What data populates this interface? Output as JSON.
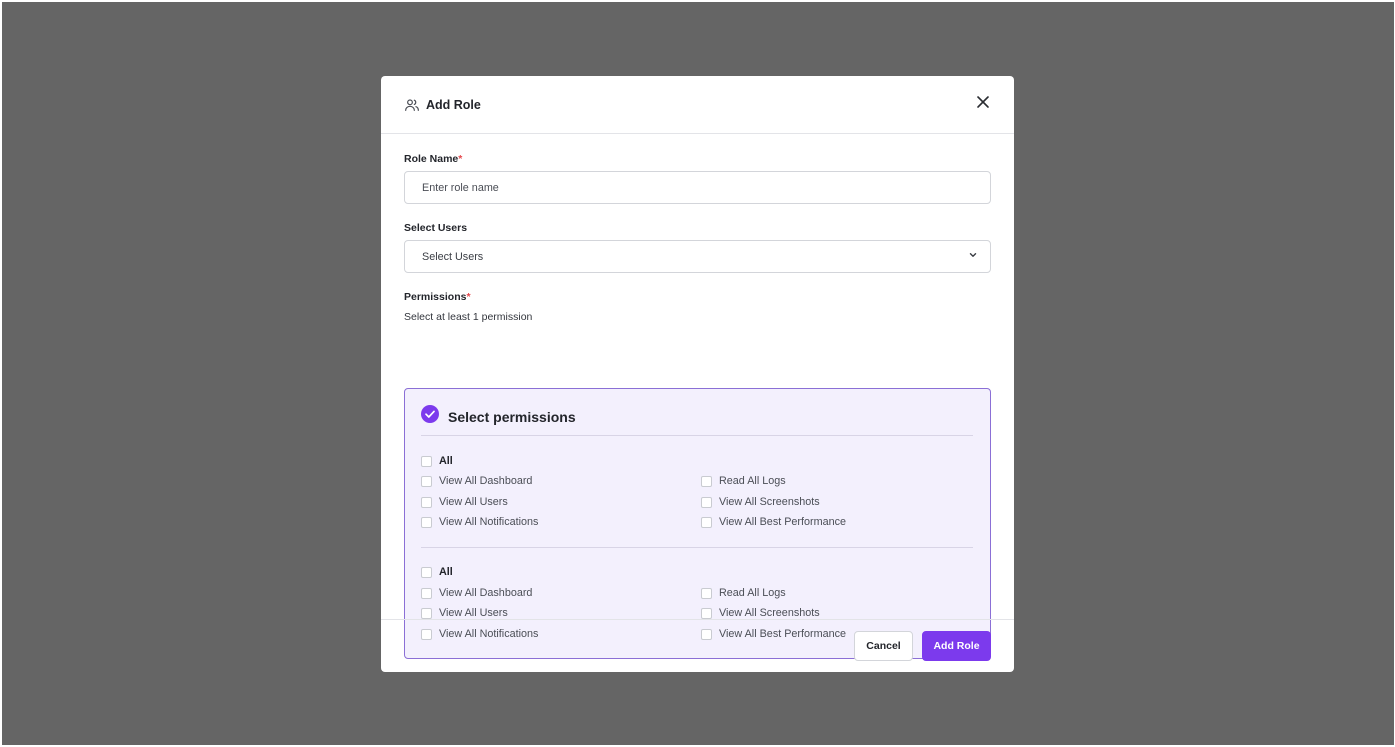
{
  "modal": {
    "title": "Add Role",
    "icon": "users-icon",
    "close_icon": "close-icon"
  },
  "role_name": {
    "label": "Role Name",
    "required_mark": "*",
    "placeholder": "Enter role name",
    "value": ""
  },
  "select_users": {
    "label": "Select Users",
    "selected": "Select Users",
    "icon": "chevron-down-icon"
  },
  "permissions": {
    "label": "Permissions",
    "required_mark": "*",
    "helper": "Select at least 1 permission",
    "box_title": "Select permissions",
    "box_icon": "check-circle-icon",
    "groups": [
      {
        "all_label": "All",
        "left": [
          "View All Dashboard",
          "View All Users",
          "View All Notifications"
        ],
        "right": [
          "Read All Logs",
          "View All Screenshots",
          "View All Best Performance"
        ]
      },
      {
        "all_label": "All",
        "left": [
          "View All Dashboard",
          "View All Users",
          "View All Notifications"
        ],
        "right": [
          "Read All Logs",
          "View All Screenshots",
          "View All Best Performance"
        ]
      }
    ]
  },
  "footer": {
    "cancel_label": "Cancel",
    "submit_label": "Add Role"
  },
  "colors": {
    "accent": "#7c3aed",
    "overlay": "#656565",
    "permission_box_bg": "#f3f0fd",
    "permission_box_border": "#8b6fd6",
    "required": "#e5484d"
  }
}
